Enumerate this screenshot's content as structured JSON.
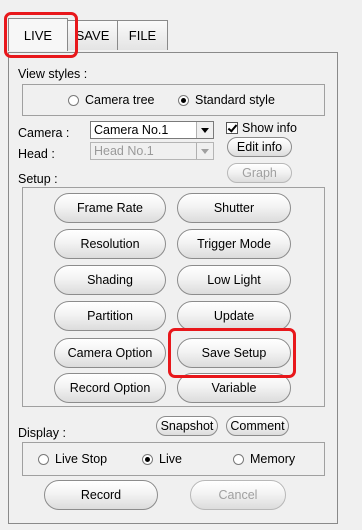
{
  "tabs": [
    {
      "label": "LIVE",
      "active": true
    },
    {
      "label": "SAVE",
      "active": false
    },
    {
      "label": "FILE",
      "active": false
    }
  ],
  "view_styles": {
    "label": "View styles :",
    "options": [
      {
        "label": "Camera tree",
        "selected": false
      },
      {
        "label": "Standard style",
        "selected": true
      }
    ]
  },
  "camera": {
    "label": "Camera :",
    "value": "Camera No.1",
    "head_label": "Head :",
    "head_value": "Head No.1",
    "show_info_label": "Show info",
    "show_info_checked": true,
    "edit_info_label": "Edit info",
    "graph_label": "Graph"
  },
  "setup": {
    "label": "Setup :",
    "buttons": [
      "Frame Rate",
      "Shutter",
      "Resolution",
      "Trigger Mode",
      "Shading",
      "Low Light",
      "Partition",
      "Update",
      "Camera Option",
      "Save Setup",
      "Record Option",
      "Variable"
    ]
  },
  "display": {
    "label": "Display :",
    "snapshot_label": "Snapshot",
    "comment_label": "Comment",
    "options": [
      {
        "label": "Live Stop",
        "selected": false
      },
      {
        "label": "Live",
        "selected": true
      },
      {
        "label": "Memory",
        "selected": false
      }
    ],
    "record_label": "Record",
    "cancel_label": "Cancel"
  },
  "colors": {
    "highlight": "#e8171b"
  }
}
